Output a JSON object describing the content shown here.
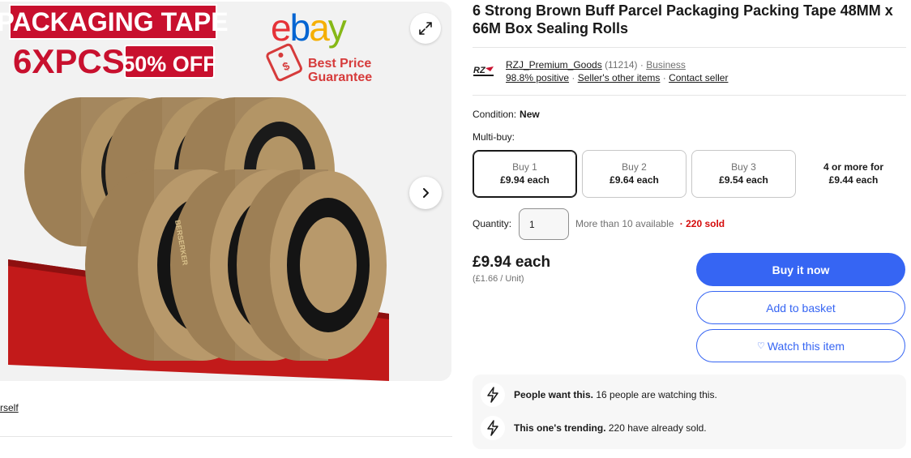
{
  "gallery": {
    "image_text": {
      "banner": "PACKAGING TAPE",
      "count": "6XPCS",
      "discount": "50% OFF",
      "brand_logo": "ebay",
      "badge": "Best Price Guarantee",
      "tape_print": "BERSERKER"
    },
    "icons": {
      "expand": "expand-icon",
      "next": "chevron-right-icon"
    }
  },
  "left_link": "rself",
  "item": {
    "title": "6 Strong Brown Buff Parcel Packaging Packing Tape 48MM x 66M Box Sealing Rolls"
  },
  "seller": {
    "name": "RZJ_Premium_Goods",
    "feedback_count": "(11214)",
    "type": "Business",
    "positive": "98.8% positive",
    "other_items": "Seller's other items",
    "contact": "Contact seller",
    "separator": "·"
  },
  "condition": {
    "label": "Condition:",
    "value": "New"
  },
  "multibuy": {
    "label": "Multi-buy:",
    "options": [
      {
        "qty": "Buy 1",
        "price": "£9.94 each",
        "selected": true
      },
      {
        "qty": "Buy 2",
        "price": "£9.64 each",
        "selected": false
      },
      {
        "qty": "Buy 3",
        "price": "£9.54 each",
        "selected": false
      }
    ],
    "more": {
      "qty": "4 or more for",
      "price": "£9.44 each"
    }
  },
  "quantity": {
    "label": "Quantity:",
    "value": "1",
    "available": "More than 10 available",
    "sold": "220 sold"
  },
  "price": {
    "main": "£9.94 each",
    "unit": "(£1.66 / Unit)"
  },
  "actions": {
    "buy_now": "Buy it now",
    "add_to_basket": "Add to basket",
    "watch": "Watch this item",
    "watch_icon": "heart-icon"
  },
  "signals": [
    {
      "icon": "lightning-icon",
      "bold": "People want this.",
      "text": "16 people are watching this."
    },
    {
      "icon": "lightning-icon",
      "bold": "This one's trending.",
      "text": "220 have already sold."
    }
  ],
  "colors": {
    "primary_blue": "#3665f3",
    "sold_red": "#d50b0b",
    "text": "#191919",
    "muted": "#707070",
    "banner_red": "#c8102e",
    "tape_brown": "#a4875e"
  }
}
